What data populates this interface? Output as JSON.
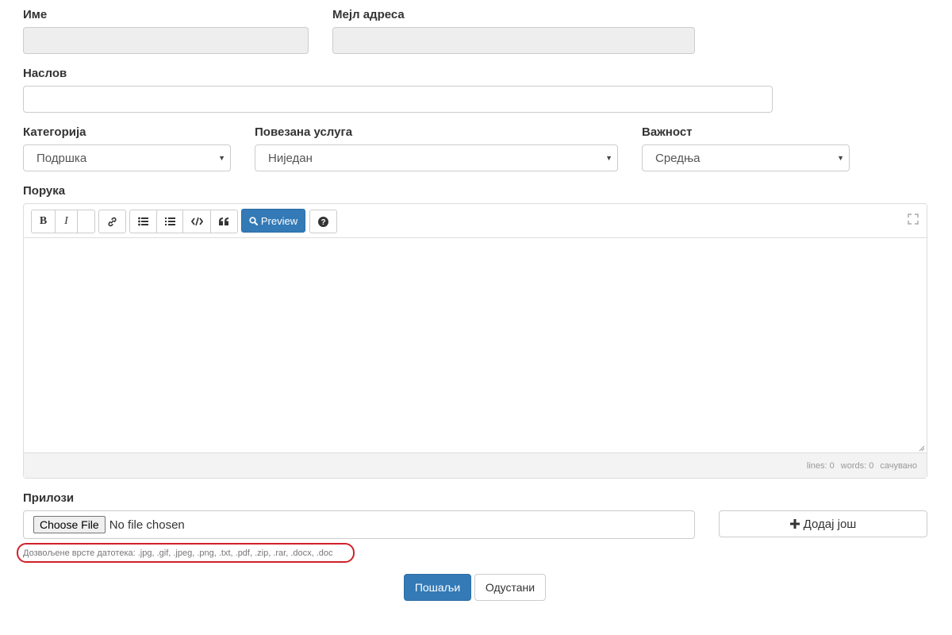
{
  "form": {
    "name_label": "Име",
    "email_label": "Мејл адреса",
    "subject_label": "Наслов",
    "category_label": "Категорија",
    "category_value": "Подршка",
    "service_label": "Повезана услуга",
    "service_value": "Ниједан",
    "priority_label": "Важност",
    "priority_value": "Средња",
    "message_label": "Порука"
  },
  "editor": {
    "toolbar": {
      "bold": "B",
      "italic": "I",
      "preview_label": "Preview"
    },
    "status": {
      "lines": "lines: 0",
      "words": "words: 0",
      "saved": "сачувано"
    }
  },
  "attachments": {
    "label": "Прилози",
    "choose_file": "Choose File",
    "no_file": "No file chosen",
    "add_more": "Додај још",
    "allowed_types": "Дозвољене врсте датотека: .jpg, .gif, .jpeg, .png, .txt, .pdf, .zip, .rar, .docx, .doc"
  },
  "actions": {
    "submit": "Пошаљи",
    "cancel": "Одустани"
  },
  "colors": {
    "primary": "#337ab7",
    "highlight": "#d0212b"
  }
}
